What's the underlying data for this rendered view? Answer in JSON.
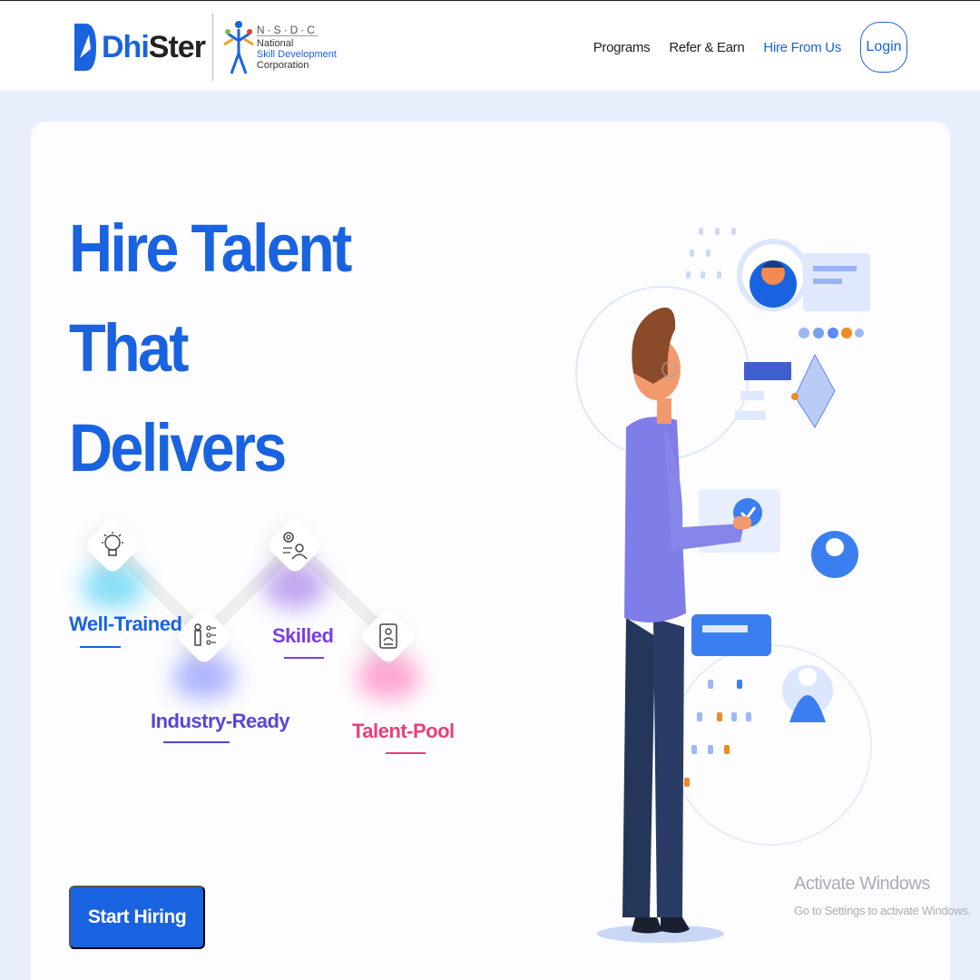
{
  "header": {
    "logo_text_prefix": "Dhi",
    "logo_text_suffix": "Ster",
    "partner": {
      "abbr": "N·S·D·C",
      "line1": "National",
      "line2": "Skill Development",
      "line3": "Corporation"
    },
    "nav": {
      "programs": "Programs",
      "refer": "Refer & Earn",
      "hire": "Hire From Us",
      "login": "Login"
    }
  },
  "hero": {
    "headline_line1": "Hire Talent That",
    "headline_line2": "Delivers",
    "steps": [
      {
        "label": "Well-Trained",
        "color": "#1a63e0",
        "glow": "#28c6f0"
      },
      {
        "label": "Industry-Ready",
        "color": "#5b45d6",
        "glow": "#5060ff"
      },
      {
        "label": "Skilled",
        "color": "#7a3fe0",
        "glow": "#7a3fe0"
      },
      {
        "label": "Talent-Pool",
        "color": "#e8407a",
        "glow": "#ff3ea0"
      }
    ],
    "cta": "Start Hiring"
  },
  "watermark": {
    "title": "Activate Windows",
    "subtitle": "Go to Settings to activate Windows."
  },
  "colors": {
    "brand": "#1a63e0",
    "page_bg": "#e8eefb",
    "accent_orange": "#f08a24"
  }
}
